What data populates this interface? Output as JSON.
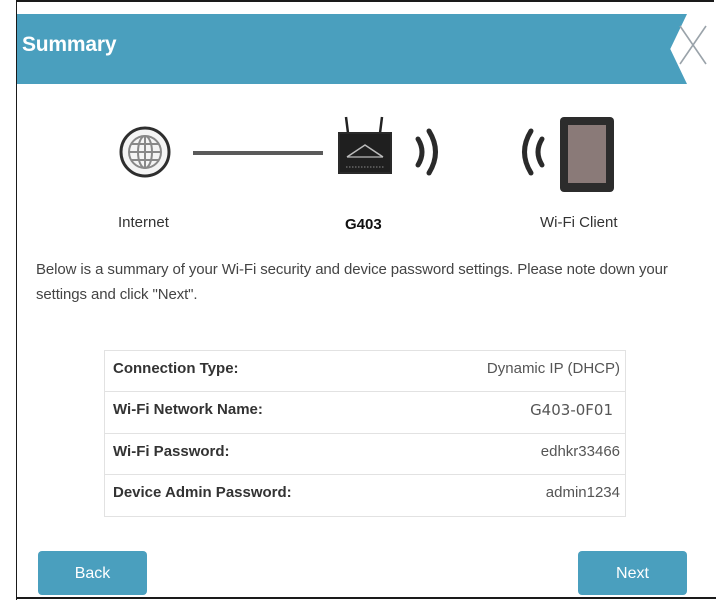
{
  "header": {
    "title": "Summary"
  },
  "topology": {
    "internet_label": "Internet",
    "router_label": "G403",
    "client_label": "Wi-Fi Client"
  },
  "description": "Below is a summary of your Wi-Fi security and device password settings. Please note down your settings and click \"Next\".",
  "summary": {
    "rows": [
      {
        "key": "Connection Type:",
        "value": "Dynamic IP (DHCP)"
      },
      {
        "key": "Wi-Fi Network Name:",
        "value": "G403-0F01"
      },
      {
        "key": "Wi-Fi Password:",
        "value": "edhkr33466"
      },
      {
        "key": "Device Admin Password:",
        "value": "admin1234"
      }
    ]
  },
  "buttons": {
    "back": "Back",
    "next": "Next"
  },
  "colors": {
    "accent": "#4a9fbe",
    "header_text": "#ffffff"
  },
  "icons": [
    "close-icon",
    "globe-icon",
    "router-icon",
    "wifi-signal-icon",
    "tablet-icon"
  ]
}
